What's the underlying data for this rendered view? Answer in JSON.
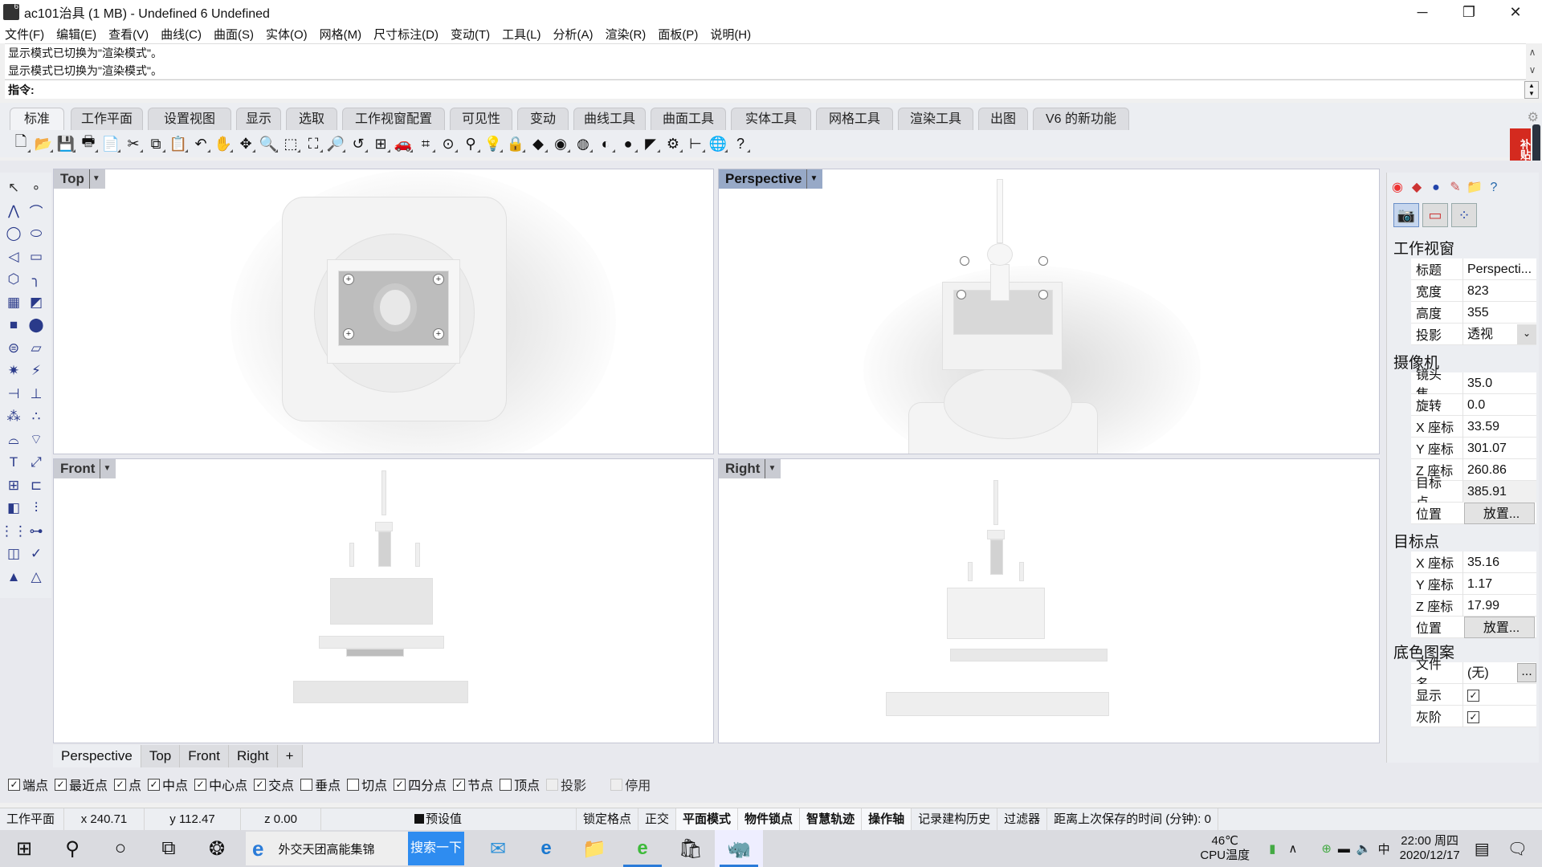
{
  "window": {
    "title": "ac101治具 (1 MB) - Undefined 6 Undefined",
    "minimize_glyph": "─",
    "restore_glyph": "❐",
    "close_glyph": "✕"
  },
  "menu": [
    "文件(F)",
    "编辑(E)",
    "查看(V)",
    "曲线(C)",
    "曲面(S)",
    "实体(O)",
    "网格(M)",
    "尺寸标注(D)",
    "变动(T)",
    "工具(L)",
    "分析(A)",
    "渲染(R)",
    "面板(P)",
    "说明(H)"
  ],
  "command": {
    "history": [
      "显示模式已切换为\"渲染模式\"。",
      "显示模式已切换为\"渲染模式\"。"
    ],
    "prompt": "指令:",
    "value": ""
  },
  "toolbar_tabs": [
    {
      "label": "标准",
      "active": true
    },
    {
      "label": "工作平面"
    },
    {
      "label": "设置视图"
    },
    {
      "label": "显示"
    },
    {
      "label": "选取"
    },
    {
      "label": "工作视窗配置"
    },
    {
      "label": "可见性"
    },
    {
      "label": "变动"
    },
    {
      "label": "曲线工具"
    },
    {
      "label": "曲面工具"
    },
    {
      "label": "实体工具"
    },
    {
      "label": "网格工具"
    },
    {
      "label": "渲染工具"
    },
    {
      "label": "出图"
    },
    {
      "label": "V6 的新功能"
    }
  ],
  "toolbar_icons": [
    {
      "name": "new-file-icon",
      "glyph": "🗋"
    },
    {
      "name": "open-file-icon",
      "glyph": "📂"
    },
    {
      "name": "save-icon",
      "glyph": "💾"
    },
    {
      "name": "print-icon",
      "glyph": "🖶"
    },
    {
      "name": "export-icon",
      "glyph": "📄"
    },
    {
      "name": "cut-icon",
      "glyph": "✂"
    },
    {
      "name": "copy-icon",
      "glyph": "⧉"
    },
    {
      "name": "paste-icon",
      "glyph": "📋"
    },
    {
      "name": "undo-icon",
      "glyph": "↶"
    },
    {
      "name": "pan-icon",
      "glyph": "✋"
    },
    {
      "name": "rotate-view-icon",
      "glyph": "✥"
    },
    {
      "name": "zoom-dynamic-icon",
      "glyph": "🔍"
    },
    {
      "name": "zoom-window-icon",
      "glyph": "⬚"
    },
    {
      "name": "zoom-extents-icon",
      "glyph": "⛶"
    },
    {
      "name": "zoom-selected-icon",
      "glyph": "🔎"
    },
    {
      "name": "undo-view-icon",
      "glyph": "↺"
    },
    {
      "name": "four-viewports-icon",
      "glyph": "⊞"
    },
    {
      "name": "car-icon",
      "glyph": "🚗"
    },
    {
      "name": "cplane-icon",
      "glyph": "⌗"
    },
    {
      "name": "object-snap-icon",
      "glyph": "⊙"
    },
    {
      "name": "gumball-icon",
      "glyph": "⚲"
    },
    {
      "name": "light-bulb-icon",
      "glyph": "💡"
    },
    {
      "name": "lock-icon",
      "glyph": "🔒"
    },
    {
      "name": "layer-icon",
      "glyph": "◆"
    },
    {
      "name": "color-wheel-icon",
      "glyph": "◉"
    },
    {
      "name": "wireframe-sphere-icon",
      "glyph": "◍"
    },
    {
      "name": "shaded-sphere-icon",
      "glyph": "◐"
    },
    {
      "name": "render-sphere-icon",
      "glyph": "●"
    },
    {
      "name": "material-icon",
      "glyph": "◤"
    },
    {
      "name": "options-gear-icon",
      "glyph": "⚙"
    },
    {
      "name": "dimension-icon",
      "glyph": "⊢"
    },
    {
      "name": "globe-icon",
      "glyph": "🌐"
    },
    {
      "name": "help-icon",
      "glyph": "?"
    }
  ],
  "left_tools": [
    [
      "select-arrow-icon",
      "↖"
    ],
    [
      "point-icon",
      "∘"
    ],
    [
      "polyline-icon",
      "⋀"
    ],
    [
      "curve-icon",
      "⌒"
    ],
    [
      "circle-icon",
      "◯"
    ],
    [
      "ellipse-icon",
      "⬭"
    ],
    [
      "arc-icon",
      "◁"
    ],
    [
      "rectangle-icon",
      "▭"
    ],
    [
      "polygon-icon",
      "⬡"
    ],
    [
      "fillet-curve-icon",
      "╮"
    ],
    [
      "surface-pts-icon",
      "▦"
    ],
    [
      "extrude-surface-icon",
      "◩"
    ],
    [
      "box-solid-icon",
      "■"
    ],
    [
      "boolean-spheres-icon",
      "⬤"
    ],
    [
      "cylinder-icon",
      "⊜"
    ],
    [
      "mesh-icon",
      "▱"
    ],
    [
      "explode-icon",
      "✷"
    ],
    [
      "burst-icon",
      "⚡"
    ],
    [
      "trim-icon",
      "⊣"
    ],
    [
      "split-icon",
      "⊥"
    ],
    [
      "group-icon",
      "⁂"
    ],
    [
      "ungroup-icon",
      "∴"
    ],
    [
      "offset-curve-icon",
      "⌓"
    ],
    [
      "blend-curve-icon",
      "⌔"
    ],
    [
      "text-icon",
      "T"
    ],
    [
      "scale-icon",
      "⤢"
    ],
    [
      "array-icon",
      "⊞"
    ],
    [
      "align-icon",
      "⊏"
    ],
    [
      "solid-edit-icon",
      "◧"
    ],
    [
      "project-icon",
      "⫶"
    ],
    [
      "grid-array-icon",
      "⋮⋮"
    ],
    [
      "dimension-linear-icon",
      "⊶"
    ],
    [
      "mirror-icon",
      "◫"
    ],
    [
      "check-icon",
      "✓"
    ],
    [
      "primitives-icon",
      "▲"
    ],
    [
      "render-pyramid-icon",
      "△"
    ]
  ],
  "viewports": [
    {
      "label": "Top",
      "active": false
    },
    {
      "label": "Perspective",
      "active": true
    },
    {
      "label": "Front",
      "active": false
    },
    {
      "label": "Right",
      "active": false
    }
  ],
  "viewport_tabs": [
    {
      "label": "Perspective",
      "active": true
    },
    {
      "label": "Top"
    },
    {
      "label": "Front"
    },
    {
      "label": "Right"
    },
    {
      "label": "+"
    }
  ],
  "osnaps": [
    {
      "label": "端点",
      "checked": true
    },
    {
      "label": "最近点",
      "checked": true
    },
    {
      "label": "点",
      "checked": true
    },
    {
      "label": "中点",
      "checked": true
    },
    {
      "label": "中心点",
      "checked": true
    },
    {
      "label": "交点",
      "checked": true
    },
    {
      "label": "垂点",
      "checked": false
    },
    {
      "label": "切点",
      "checked": false
    },
    {
      "label": "四分点",
      "checked": true
    },
    {
      "label": "节点",
      "checked": true
    },
    {
      "label": "顶点",
      "checked": false
    },
    {
      "label": "投影",
      "checked": false,
      "disabled": true
    },
    {
      "label": "停用",
      "checked": false,
      "disabled": true
    }
  ],
  "status": {
    "cplane": "工作平面",
    "x": "x 240.71",
    "y": "y 112.47",
    "z": "z 0.00",
    "layer": "预设值",
    "items": [
      {
        "label": "锁定格点",
        "bold": false
      },
      {
        "label": "正交",
        "bold": false
      },
      {
        "label": "平面模式",
        "bold": true
      },
      {
        "label": "物件锁点",
        "bold": true
      },
      {
        "label": "智慧轨迹",
        "bold": true
      },
      {
        "label": "操作轴",
        "bold": true
      },
      {
        "label": "记录建构历史",
        "bold": false
      },
      {
        "label": "过滤器",
        "bold": false
      },
      {
        "label": "距离上次保存的时间 (分钟): 0",
        "bold": false
      }
    ]
  },
  "panel": {
    "tab_icons": [
      "color-wheel-icon",
      "layer-icon",
      "material-ball-icon",
      "brush-icon",
      "folder-icon",
      "help-icon"
    ],
    "sub_buttons": [
      "camera-icon",
      "viewport-frame-icon",
      "spheres-icon"
    ],
    "viewport_section": "工作视窗",
    "viewport_rows": [
      {
        "k": "标题",
        "v": "Perspecti..."
      },
      {
        "k": "宽度",
        "v": "823"
      },
      {
        "k": "高度",
        "v": "355"
      },
      {
        "k": "投影",
        "v": "透视"
      }
    ],
    "camera_section": "摄像机",
    "camera_rows": [
      {
        "k": "镜头焦...",
        "v": "35.0"
      },
      {
        "k": "旋转",
        "v": "0.0"
      },
      {
        "k": "X 座标",
        "v": "33.59"
      },
      {
        "k": "Y 座标",
        "v": "301.07"
      },
      {
        "k": "Z 座标",
        "v": "260.86"
      },
      {
        "k": "目标点...",
        "v": "385.91"
      },
      {
        "k": "位置",
        "v": "放置..."
      }
    ],
    "target_section": "目标点",
    "target_rows": [
      {
        "k": "X 座标",
        "v": "35.16"
      },
      {
        "k": "Y 座标",
        "v": "1.17"
      },
      {
        "k": "Z 座标",
        "v": "17.99"
      },
      {
        "k": "位置",
        "v": "放置..."
      }
    ],
    "wallpaper_section": "底色图案",
    "wallpaper_rows": [
      {
        "k": "文件名...",
        "v": "(无)",
        "btn": "..."
      },
      {
        "k": "显示",
        "checked": true
      },
      {
        "k": "灰阶",
        "checked": true
      }
    ]
  },
  "promo_badge": "补贴金",
  "taskbar": {
    "search_text": "外交天团高能集锦",
    "search_button": "搜索一下",
    "temperature": "46℃",
    "temperature_label": "CPU温度",
    "ime": "中",
    "time": "22:00 周四",
    "date": "2020/12/17"
  }
}
